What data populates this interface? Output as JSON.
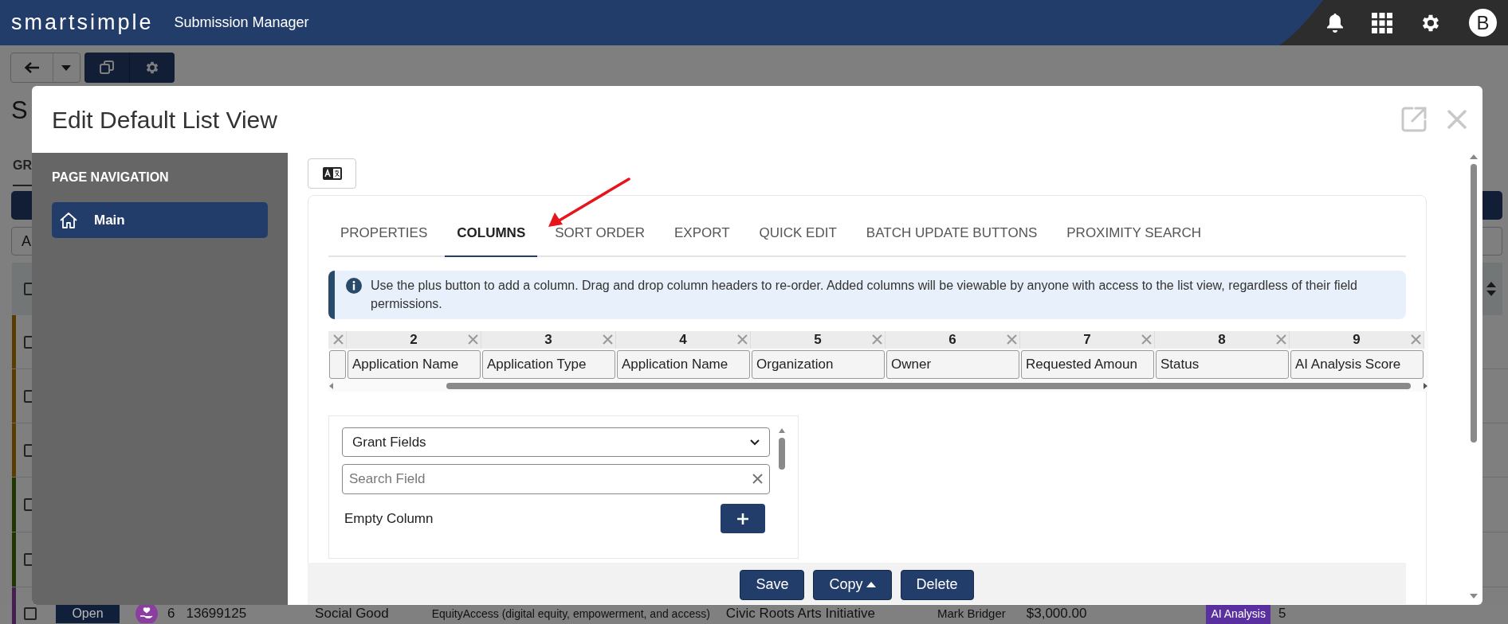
{
  "app_bar": {
    "logo": "smartsimple",
    "title": "Submission Manager",
    "avatar": "B"
  },
  "background_page": {
    "title": "S",
    "tab": "GR",
    "left_button": "A",
    "header_checked": false,
    "rows": [
      {
        "color": "#583c00",
        "checked": false
      },
      {
        "color": "#583c00",
        "checked": false
      },
      {
        "color": "#583c00",
        "checked": false
      },
      {
        "color": "#1f3600",
        "checked": false
      },
      {
        "color": "#1f3600",
        "checked": false
      }
    ],
    "last_row": {
      "color": "#451f50",
      "checked": false,
      "status": "Open",
      "number": "6",
      "id": "13699125",
      "category": "Social Good",
      "description": "EquityAccess (digital equity, empowerment, and access)",
      "organization": "Civic Roots Arts Initiative",
      "owner": "Mark Bridger",
      "amount": "$3,000.00",
      "badge": "AI Analysis",
      "score": "5"
    }
  },
  "dialog": {
    "title": "Edit Default List View",
    "nav_heading": "PAGE NAVIGATION",
    "nav_items": [
      {
        "label": "Main",
        "selected": true
      }
    ],
    "tabs": [
      {
        "label": "PROPERTIES",
        "selected": false
      },
      {
        "label": "COLUMNS",
        "selected": true
      },
      {
        "label": "SORT ORDER",
        "selected": false
      },
      {
        "label": "EXPORT",
        "selected": false
      },
      {
        "label": "QUICK EDIT",
        "selected": false
      },
      {
        "label": "BATCH UPDATE BUTTONS",
        "selected": false
      },
      {
        "label": "PROXIMITY SEARCH",
        "selected": false
      }
    ],
    "info": "Use the plus button to add a column. Drag and drop column headers to re-order. Added columns will be viewable by anyone with access to the list view, regardless of their field permissions.",
    "columns": [
      {
        "kind": "partial"
      },
      {
        "kind": "full",
        "number": "2",
        "label": "Application Name"
      },
      {
        "kind": "full",
        "number": "3",
        "label": "Application Type"
      },
      {
        "kind": "full",
        "number": "4",
        "label": "Application Name"
      },
      {
        "kind": "full",
        "number": "5",
        "label": "Organization"
      },
      {
        "kind": "full",
        "number": "6",
        "label": "Owner"
      },
      {
        "kind": "full",
        "number": "7",
        "label": "Requested Amoun"
      },
      {
        "kind": "full",
        "number": "8",
        "label": "Status"
      },
      {
        "kind": "full",
        "number": "9",
        "label": "AI Analysis Score"
      }
    ],
    "field_picker": {
      "group": "Grant Fields",
      "search_placeholder": "Search Field",
      "items": [
        {
          "label": "Empty Column"
        }
      ]
    },
    "buttons": [
      {
        "label": "Save",
        "kind": "plain"
      },
      {
        "label": "Copy",
        "kind": "dropdown"
      },
      {
        "label": "Delete",
        "kind": "plain"
      }
    ]
  }
}
